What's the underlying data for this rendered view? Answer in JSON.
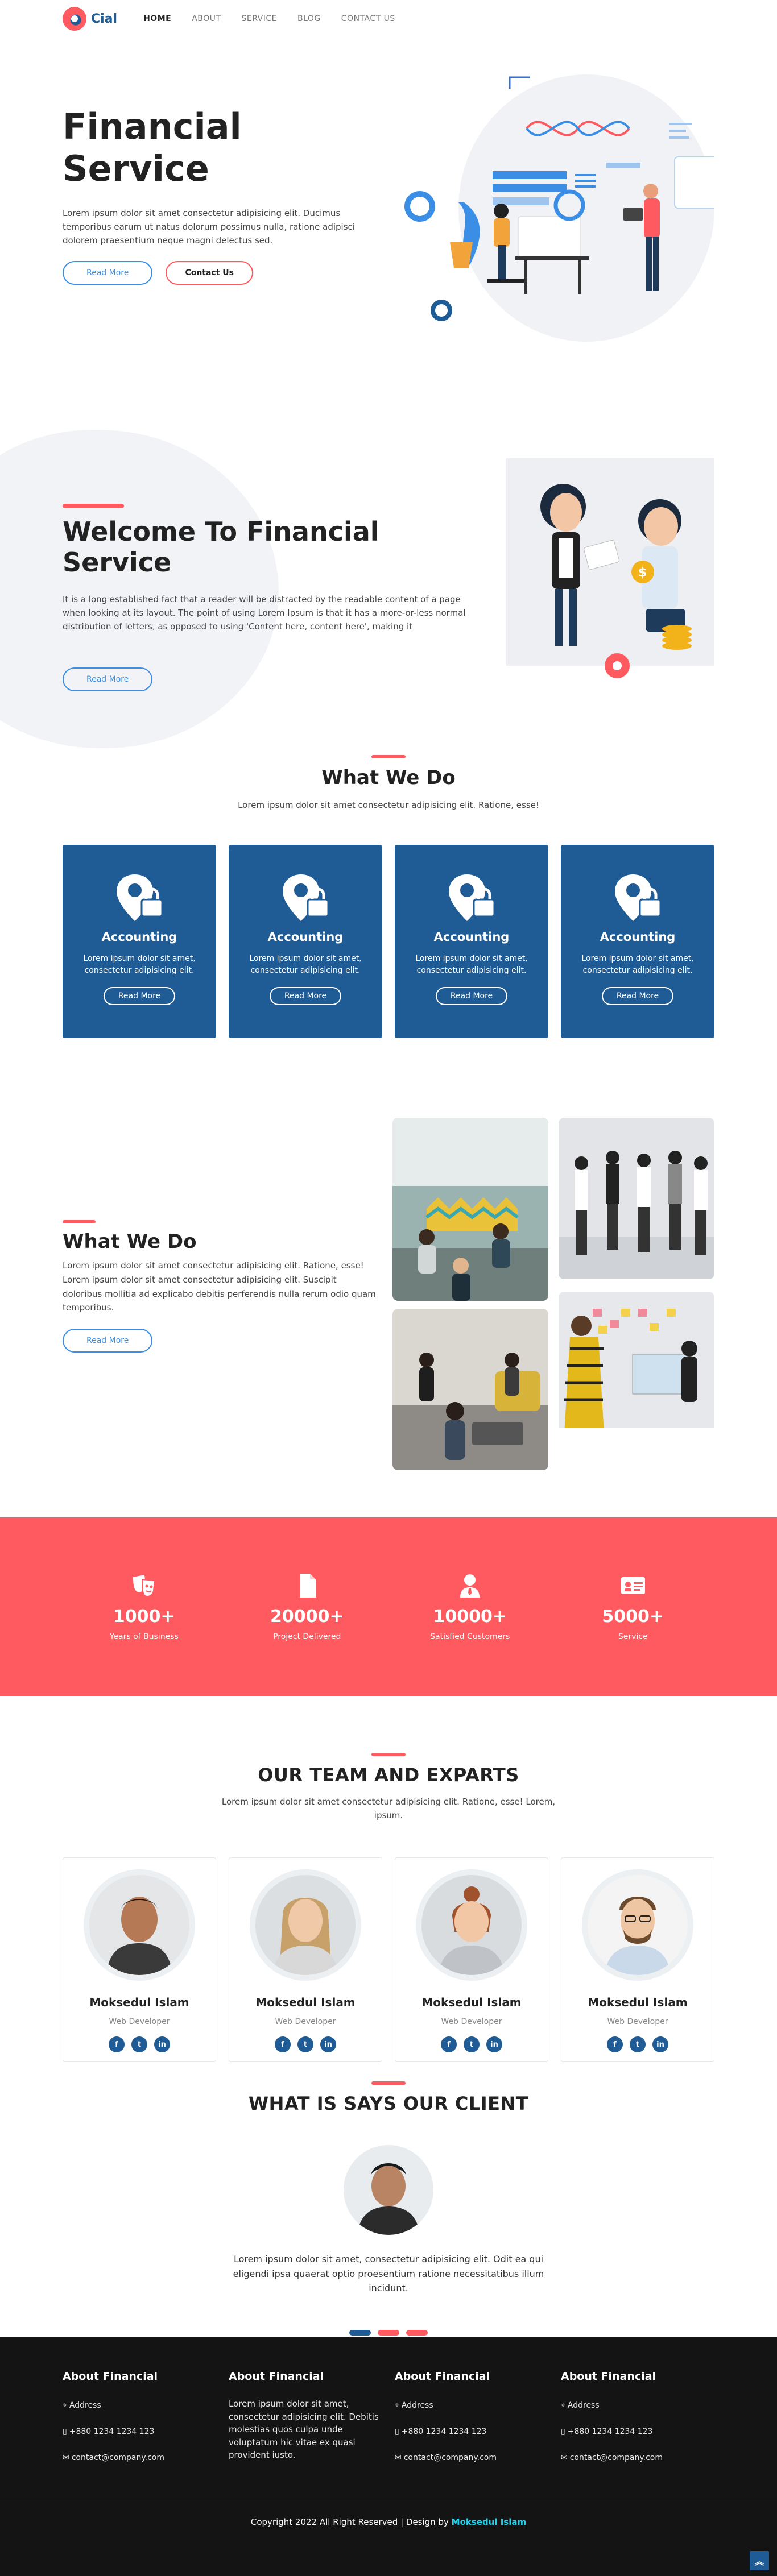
{
  "header": {
    "logo_text": "Cial",
    "nav": [
      "HOME",
      "ABOUT",
      "SERVICE",
      "BLOG",
      "CONTACT US"
    ]
  },
  "hero": {
    "title": "Financial Service",
    "description": "Lorem ipsum dolor sit amet consectetur adipisicing elit. Ducimus temporibus earum ut natus dolorum possimus nulla, ratione adipisci dolorem praesentium neque magni delectus sed.",
    "read_more": "Read More",
    "contact": "Contact Us"
  },
  "welcome": {
    "title": "Welcome To Financial Service",
    "description": "It is a long established fact that a reader will be distracted by the readable content of a page when looking at its layout. The point of using Lorem Ipsum is that it has a more-or-less normal distribution of letters, as opposed to using 'Content here, content here', making it",
    "read_more": "Read More"
  },
  "services": {
    "title": "What We Do",
    "subtitle": "Lorem ipsum dolor sit amet consectetur adipisicing elit. Ratione, esse!",
    "cards": [
      {
        "title": "Accounting",
        "text": "Lorem ipsum dolor sit amet, consectetur adipisicing elit.",
        "button": "Read More"
      },
      {
        "title": "Accounting",
        "text": "Lorem ipsum dolor sit amet, consectetur adipisicing elit.",
        "button": "Read More"
      },
      {
        "title": "Accounting",
        "text": "Lorem ipsum dolor sit amet, consectetur adipisicing elit.",
        "button": "Read More"
      },
      {
        "title": "Accounting",
        "text": "Lorem ipsum dolor sit amet, consectetur adipisicing elit.",
        "button": "Read More"
      }
    ]
  },
  "what_we_do_2": {
    "title": "What We Do",
    "description": "Lorem ipsum dolor sit amet consectetur adipisicing elit. Ratione, esse! Lorem ipsum dolor sit amet consectetur adipisicing elit. Suscipit doloribus mollitia ad explicabo debitis perferendis nulla rerum odio quam temporibus.",
    "read_more": "Read More"
  },
  "stats": [
    {
      "number": "1000+",
      "label": "Years of Business",
      "icon": "masks-icon"
    },
    {
      "number": "20000+",
      "label": "Project Delivered",
      "icon": "document-icon"
    },
    {
      "number": "10000+",
      "label": "Satisfied Customers",
      "icon": "user-tie-icon"
    },
    {
      "number": "5000+",
      "label": "Service",
      "icon": "id-card-icon"
    }
  ],
  "team": {
    "title": "OUR TEAM AND EXPARTS",
    "subtitle": "Lorem ipsum dolor sit amet consectetur adipisicing elit. Ratione, esse! Lorem, ipsum.",
    "members": [
      {
        "name": "Moksedul Islam",
        "role": "Web Developer"
      },
      {
        "name": "Moksedul Islam",
        "role": "Web Developer"
      },
      {
        "name": "Moksedul Islam",
        "role": "Web Developer"
      },
      {
        "name": "Moksedul Islam",
        "role": "Web Developer"
      }
    ],
    "social_icons": [
      "facebook-icon",
      "twitter-icon",
      "linkedin-icon"
    ]
  },
  "testimonial": {
    "title": "WHAT IS SAYS OUR CLIENT",
    "quote": "Lorem ipsum dolor sit amet, consectetur adipisicing elit. Odit ea qui eligendi ipsa quaerat optio proesentium ratione necessitatibus illum incidunt."
  },
  "footer": {
    "columns": [
      {
        "title": "About Financial",
        "address": "Address",
        "phone": "+880 1234 1234 123",
        "email": "contact@company.com"
      },
      {
        "title": "About Financial",
        "text": "Lorem ipsum dolor sit amet, consectetur adipisicing elit. Debitis molestias quos culpa unde voluptatum hic vitae ex quasi provident iusto."
      },
      {
        "title": "About Financial",
        "address": "Address",
        "phone": "+880 1234 1234 123",
        "email": "contact@company.com"
      },
      {
        "title": "About Financial",
        "address": "Address",
        "phone": "+880 1234 1234 123",
        "email": "contact@company.com"
      }
    ],
    "copyright": "Copyright 2022 All Right Reserved | Design by",
    "designer": "Moksedul Islam"
  },
  "colors": {
    "primary": "#1f5c96",
    "accent": "#ff5a5f",
    "link": "#3a8ee6",
    "footer_bg": "#141414"
  }
}
